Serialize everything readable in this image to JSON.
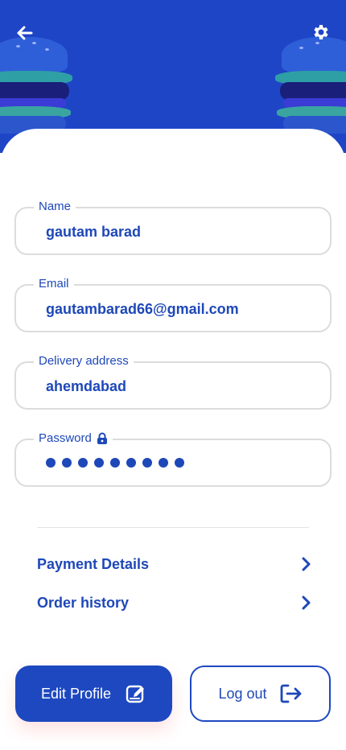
{
  "header": {
    "back_icon": "arrow-left-icon",
    "settings_icon": "gear-icon",
    "background_color": "#1f45c7"
  },
  "form": {
    "name": {
      "label": "Name",
      "value": "gautam barad"
    },
    "email": {
      "label": "Email",
      "value": "gautambarad66@gmail.com"
    },
    "address": {
      "label": "Delivery address",
      "value": "ahemdabad"
    },
    "password": {
      "label": "Password",
      "masked_length": 9,
      "icon": "lock-icon"
    }
  },
  "links": {
    "payment": "Payment Details",
    "orders": "Order history"
  },
  "actions": {
    "edit_label": "Edit Profile",
    "edit_icon": "edit-icon",
    "logout_label": "Log out",
    "logout_icon": "logout-icon"
  },
  "colors": {
    "accent": "#1e48c0",
    "text": "#1e48b8",
    "border": "#dcdcdc"
  }
}
